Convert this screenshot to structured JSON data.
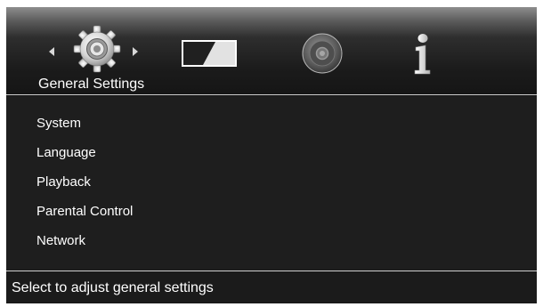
{
  "header": {
    "categories": [
      {
        "id": "general",
        "icon": "gear-icon",
        "selected": true
      },
      {
        "id": "display",
        "icon": "display-icon",
        "selected": false
      },
      {
        "id": "audio",
        "icon": "speaker-icon",
        "selected": false
      },
      {
        "id": "info",
        "icon": "info-icon",
        "selected": false
      }
    ],
    "selected_label": "General Settings"
  },
  "menu": {
    "items": [
      "System",
      "Language",
      "Playback",
      "Parental Control",
      "Network"
    ]
  },
  "status": {
    "hint": "Select to adjust general settings"
  },
  "colors": {
    "background": "#1e1e1e",
    "text": "#ffffff",
    "divider": "#cfcfcf",
    "bezel": "#ffffff"
  }
}
